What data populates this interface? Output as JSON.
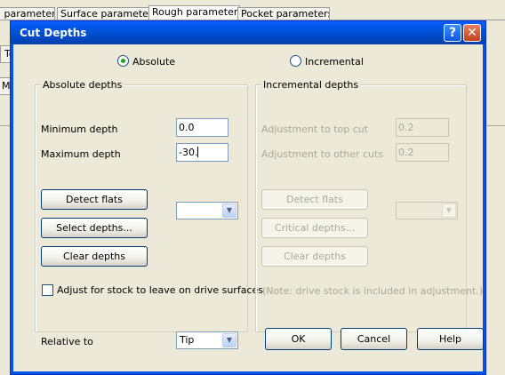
{
  "background": {
    "tabs": [
      "l parameters",
      "Surface parameters",
      "Rough parameters",
      "Pocket parameters"
    ],
    "left_labels": [
      "To",
      "Max"
    ]
  },
  "dialog": {
    "title": "Cut Depths",
    "help_glyph": "?",
    "close_glyph": "✕"
  },
  "mode": {
    "absolute_label": "Absolute",
    "incremental_label": "Incremental",
    "selected": "Absolute"
  },
  "absolute_depths": {
    "title": "Absolute depths",
    "min_label": "Minimum depth",
    "min_value": "0.0",
    "max_label": "Maximum depth",
    "max_value": "-30.",
    "detect_flats": "Detect flats",
    "select_depths": "Select depths...",
    "clear_depths": "Clear depths",
    "combo_value": "",
    "adjust_stock_label": "Adjust for stock to leave on drive surfaces",
    "adjust_stock_checked": false
  },
  "incremental_depths": {
    "title": "Incremental depths",
    "top_cut_label": "Adjustment to top cut",
    "top_cut_value": "0.2",
    "other_cuts_label": "Adjustment to other cuts",
    "other_cuts_value": "0.2",
    "detect_flats": "Detect flats",
    "critical_depths": "Critical depths...",
    "clear_depths": "Clear depths",
    "combo_value": "",
    "note": "(Note:  drive stock is included in adjustment.)"
  },
  "footer": {
    "relative_to_label": "Relative to",
    "relative_to_value": "Tip",
    "ok": "OK",
    "cancel": "Cancel",
    "help": "Help"
  },
  "colors": {
    "titlebar": "#0054e3",
    "dialog_bg": "#ece9d8",
    "disabled_text": "#aca899",
    "radio_dot": "#21a121"
  }
}
